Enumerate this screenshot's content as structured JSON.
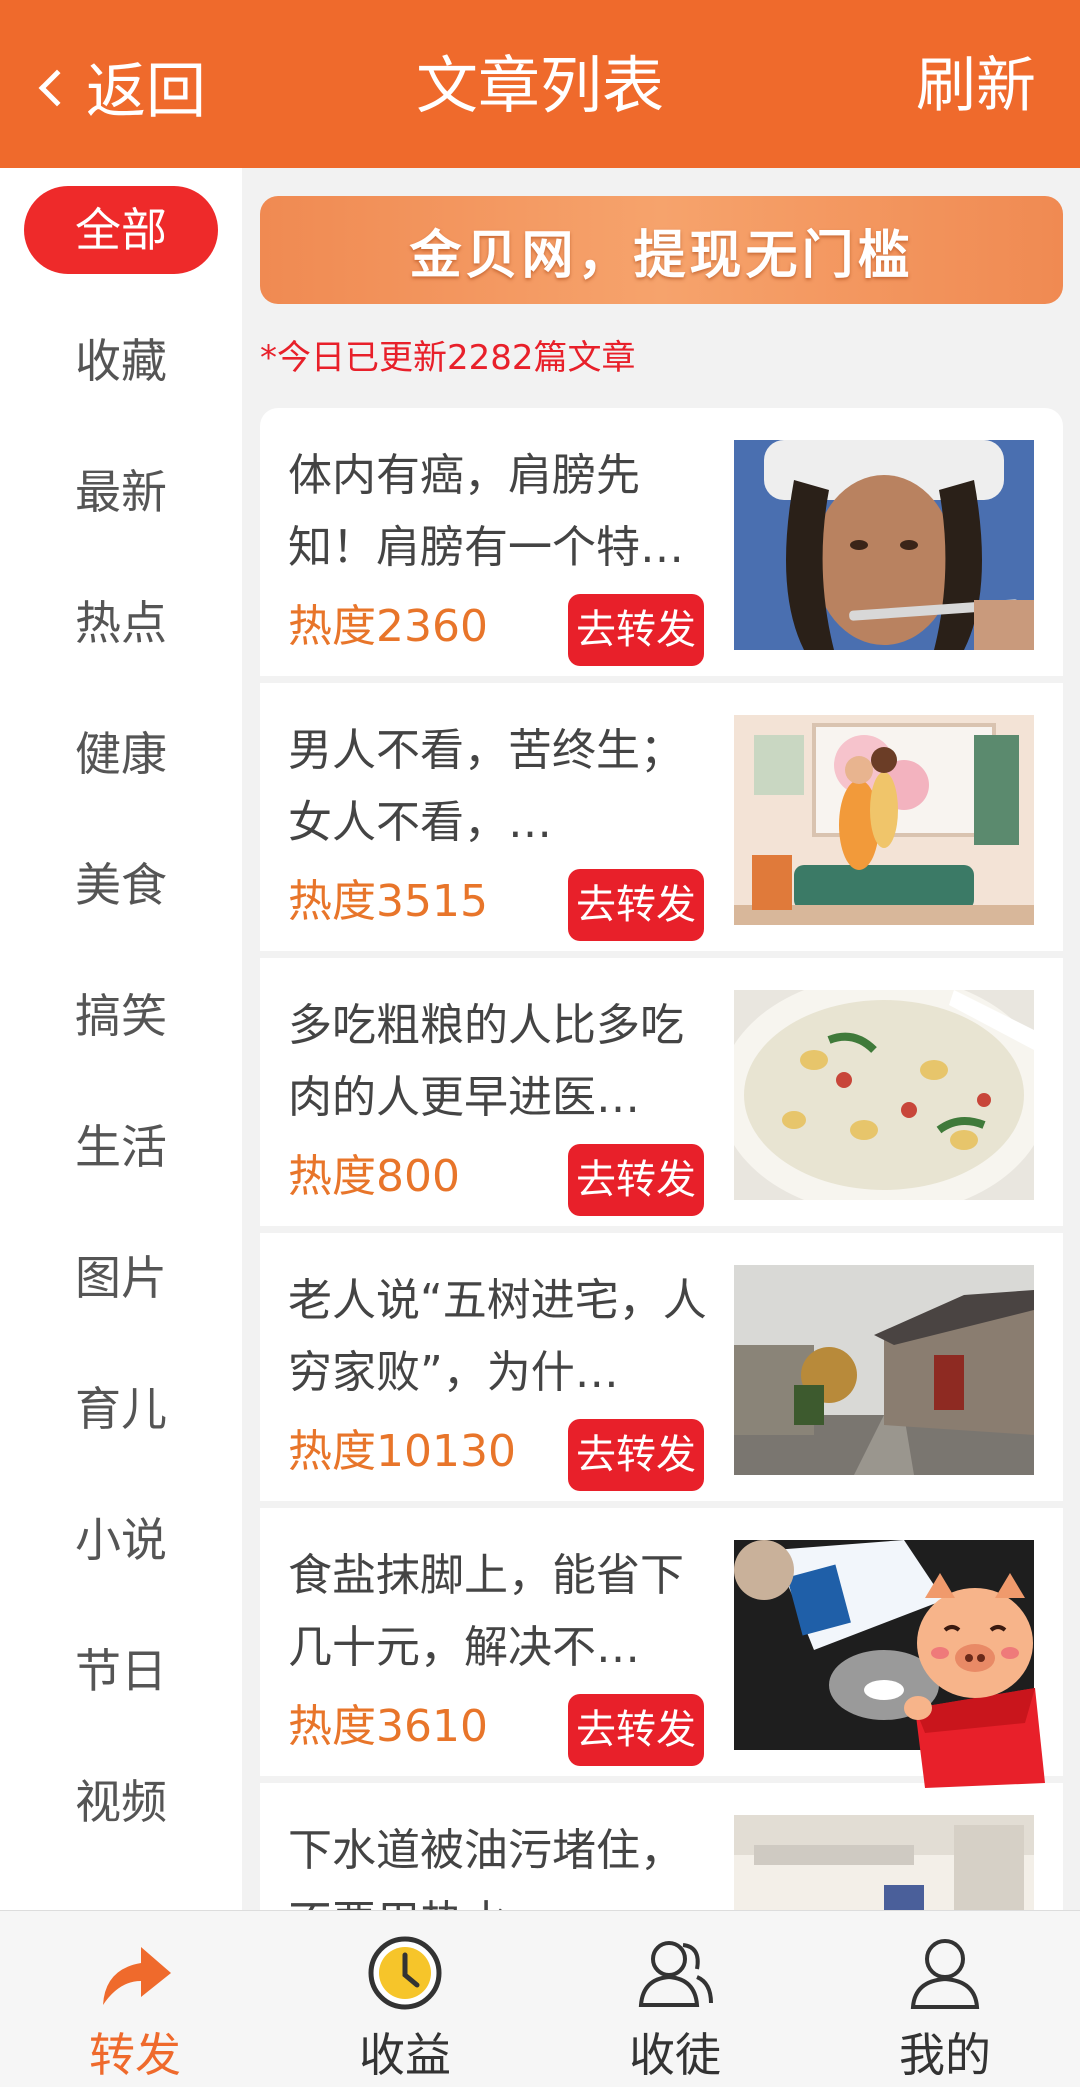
{
  "header": {
    "back_label": "返回",
    "title": "文章列表",
    "refresh_label": "刷新"
  },
  "sidebar": {
    "items": [
      {
        "label": "全部",
        "active": true
      },
      {
        "label": "收藏"
      },
      {
        "label": "最新"
      },
      {
        "label": "热点"
      },
      {
        "label": "健康"
      },
      {
        "label": "美食"
      },
      {
        "label": "搞笑"
      },
      {
        "label": "生活"
      },
      {
        "label": "图片"
      },
      {
        "label": "育儿"
      },
      {
        "label": "小说"
      },
      {
        "label": "节日"
      },
      {
        "label": "视频"
      }
    ]
  },
  "banner": {
    "text": "金贝网，提现无门槛"
  },
  "notice": "*今日已更新2282篇文章",
  "articles": [
    {
      "title": "体内有癌，肩膀先知！肩膀有一个特…",
      "heat": "热度2360",
      "share_label": "去转发",
      "thumb": "sick-woman-thermometer"
    },
    {
      "title": "男人不看，苦终生； 女人不看，…",
      "heat": "热度3515",
      "share_label": "去转发",
      "thumb": "couple-illustration"
    },
    {
      "title": "多吃粗粮的人比多吃肉的人更早进医…",
      "heat": "热度800",
      "share_label": "去转发",
      "thumb": "porridge-bowl"
    },
    {
      "title": "老人说“五树进宅，人穷家败”，为什…",
      "heat": "热度10130",
      "share_label": "去转发",
      "thumb": "old-alley-house"
    },
    {
      "title": "食盐抹脚上，能省下几十元，解决不…",
      "heat": "热度3610",
      "share_label": "去转发",
      "thumb": "salt-bag"
    },
    {
      "title": "下水道被油污堵住，不要用热水…",
      "heat": "",
      "share_label": "",
      "thumb": "kitchen"
    }
  ],
  "tabbar": {
    "items": [
      {
        "label": "转发",
        "icon": "share-arrow-icon",
        "active": true
      },
      {
        "label": "收益",
        "icon": "clock-icon"
      },
      {
        "label": "收徒",
        "icon": "users-icon"
      },
      {
        "label": "我的",
        "icon": "user-icon"
      }
    ]
  },
  "colors": {
    "brand": "#ef6a2c",
    "accent_red": "#e8202a",
    "heat": "#e8752a"
  }
}
